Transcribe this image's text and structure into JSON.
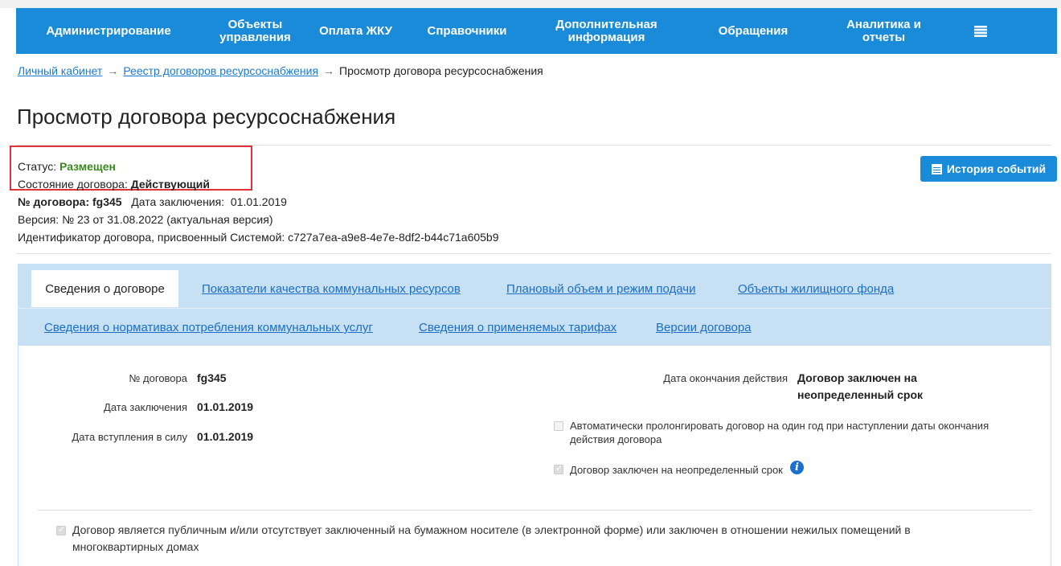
{
  "nav": {
    "items": [
      {
        "label": "Администрирование"
      },
      {
        "label": "Объекты\nуправления"
      },
      {
        "label": "Оплата ЖКУ"
      },
      {
        "label": "Справочники"
      },
      {
        "label": "Дополнительная\nинформация"
      },
      {
        "label": "Обращения"
      },
      {
        "label": "Аналитика и\nотчеты"
      }
    ],
    "menu_icon": "hamburger-menu-icon"
  },
  "breadcrumb": {
    "item1": "Личный кабинет",
    "item2": "Реестр договоров ресурсоснабжения",
    "item3": "Просмотр договора ресурсоснабжения",
    "arrow": "→"
  },
  "page_title": "Просмотр договора ресурсоснабжения",
  "meta": {
    "status_label": "Статус:",
    "status_value": "Размещен",
    "state_label": "Состояние договора:",
    "state_value": "Действующий",
    "number_label": "№ договора:",
    "number_value": "fg345",
    "date_label": "Дата заключения:",
    "date_value": "01.01.2019",
    "version_text": "Версия: № 23 от 31.08.2022 (актуальная версия)",
    "id_text": "Идентификатор договора, присвоенный Системой: c727a7ea-a9e8-4e7e-8df2-b44c71a605b9"
  },
  "history_button": "История событий",
  "tabs": {
    "active": "Сведения о договоре",
    "t2": "Показатели качества коммунальных ресурсов",
    "t3": "Плановый объем и режим подачи",
    "t4": "Объекты жилищного фонда",
    "t5": "Сведения о нормативах потребления коммунальных услуг",
    "t6": "Сведения о применяемых тарифах",
    "t7": "Версии договора"
  },
  "details": {
    "number_label": "№ договора",
    "number_value": "fg345",
    "conclusion_label": "Дата заключения",
    "conclusion_value": "01.01.2019",
    "effective_label": "Дата вступления в силу",
    "effective_value": "01.01.2019",
    "end_label": "Дата окончания действия",
    "end_value_1": "Договор заключен на",
    "end_value_2": "неопределенный срок",
    "auto_prolong_1": "Автоматически пролонгировать договор на один год при наступлении даты окончания",
    "auto_prolong_2": "действия договора",
    "indefinite": "Договор заключен на неопределенный срок",
    "public_1": "Договор является публичным и/или отсутствует заключенный на бумажном носителе (в электронной форме) или заключен в отношении нежилых помещений в",
    "public_2": "многоквартирных домах"
  },
  "colors": {
    "nav_bg": "#1a8bd8",
    "status_green": "#3a8a1e",
    "link_blue": "#1a6fc4",
    "highlight_red": "#e0323a"
  }
}
